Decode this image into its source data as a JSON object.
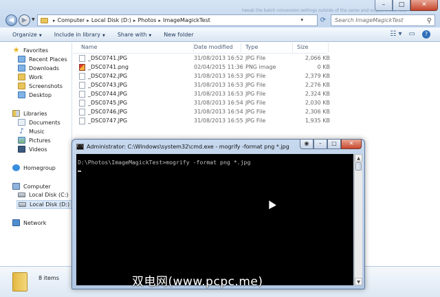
{
  "explorer": {
    "background_hint": "tweak the batch conversion settings outside of the same and output these. Use",
    "breadcrumb": [
      "Computer",
      "Local Disk (D:)",
      "Photos",
      "ImageMagickTest"
    ],
    "search_placeholder": "Search ImageMagickTest",
    "toolbar": {
      "organize": "Organize",
      "include_in_library": "Include in library",
      "share_with": "Share with",
      "new_folder": "New folder"
    },
    "nav": {
      "favorites": "Favorites",
      "recent_places": "Recent Places",
      "downloads": "Downloads",
      "work": "Work",
      "screenshots": "Screenshots",
      "desktop": "Desktop",
      "libraries": "Libraries",
      "documents": "Documents",
      "music": "Music",
      "pictures": "Pictures",
      "videos": "Videos",
      "homegroup": "Homegroup",
      "computer": "Computer",
      "local_disk_c": "Local Disk (C:)",
      "local_disk_d": "Local Disk (D:)",
      "network": "Network"
    },
    "columns": {
      "name": "Name",
      "date_modified": "Date modified",
      "type": "Type",
      "size": "Size"
    },
    "files": [
      {
        "name": "_DSC0741.JPG",
        "date": "31/08/2013 16:52",
        "type": "JPG File",
        "size": "2,066 KB"
      },
      {
        "name": "_DSC0741.png",
        "date": "02/04/2015 11:36",
        "type": "PNG image",
        "size": "0 KB"
      },
      {
        "name": "_DSC0742.JPG",
        "date": "31/08/2013 16:53",
        "type": "JPG File",
        "size": "2,379 KB"
      },
      {
        "name": "_DSC0743.JPG",
        "date": "31/08/2013 16:53",
        "type": "JPG File",
        "size": "2,276 KB"
      },
      {
        "name": "_DSC0744.JPG",
        "date": "31/08/2013 16:53",
        "type": "JPG File",
        "size": "2,324 KB"
      },
      {
        "name": "_DSC0745.JPG",
        "date": "31/08/2013 16:54",
        "type": "JPG File",
        "size": "2,030 KB"
      },
      {
        "name": "_DSC0746.JPG",
        "date": "31/08/2013 16:54",
        "type": "JPG File",
        "size": "2,306 KB"
      },
      {
        "name": "_DSC0747.JPG",
        "date": "31/08/2013 16:55",
        "type": "JPG File",
        "size": "1,935 KB"
      }
    ],
    "item_count": "8 items"
  },
  "cmd": {
    "title": "Administrator: C:\\Windows\\system32\\cmd.exe - mogrify  -format png *.jpg",
    "icon_label": "C:\\",
    "command_line": "D:\\Photos\\ImageMagickTest>mogrify -format png *.jpg"
  },
  "watermark": "双电网(www.pcpc.me)"
}
